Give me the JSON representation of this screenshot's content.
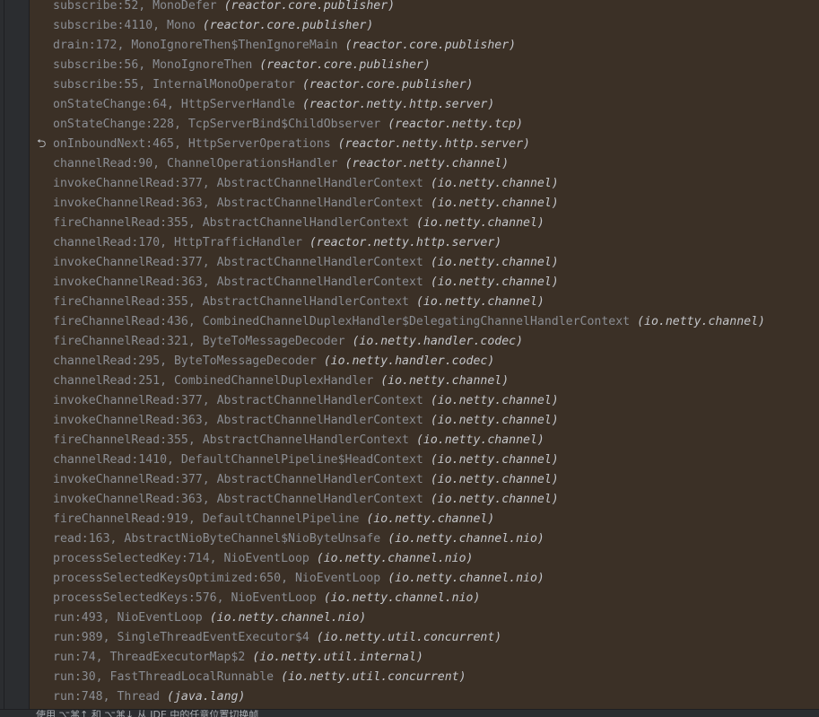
{
  "stack_frames": [
    {
      "method": "subscribe:52, MonoDefer",
      "package": "(reactor.core.publisher)"
    },
    {
      "method": "subscribe:4110, Mono",
      "package": "(reactor.core.publisher)"
    },
    {
      "method": "drain:172, MonoIgnoreThen$ThenIgnoreMain",
      "package": "(reactor.core.publisher)"
    },
    {
      "method": "subscribe:56, MonoIgnoreThen",
      "package": "(reactor.core.publisher)"
    },
    {
      "method": "subscribe:55, InternalMonoOperator",
      "package": "(reactor.core.publisher)"
    },
    {
      "method": "onStateChange:64, HttpServerHandle",
      "package": "(reactor.netty.http.server)"
    },
    {
      "method": "onStateChange:228, TcpServerBind$ChildObserver",
      "package": "(reactor.netty.tcp)"
    },
    {
      "method": "onInboundNext:465, HttpServerOperations",
      "package": "(reactor.netty.http.server)",
      "icon": "undo-arrow-icon",
      "icon_glyph": "⮌"
    },
    {
      "method": "channelRead:90, ChannelOperationsHandler",
      "package": "(reactor.netty.channel)"
    },
    {
      "method": "invokeChannelRead:377, AbstractChannelHandlerContext",
      "package": "(io.netty.channel)"
    },
    {
      "method": "invokeChannelRead:363, AbstractChannelHandlerContext",
      "package": "(io.netty.channel)"
    },
    {
      "method": "fireChannelRead:355, AbstractChannelHandlerContext",
      "package": "(io.netty.channel)"
    },
    {
      "method": "channelRead:170, HttpTrafficHandler",
      "package": "(reactor.netty.http.server)"
    },
    {
      "method": "invokeChannelRead:377, AbstractChannelHandlerContext",
      "package": "(io.netty.channel)"
    },
    {
      "method": "invokeChannelRead:363, AbstractChannelHandlerContext",
      "package": "(io.netty.channel)"
    },
    {
      "method": "fireChannelRead:355, AbstractChannelHandlerContext",
      "package": "(io.netty.channel)"
    },
    {
      "method": "fireChannelRead:436, CombinedChannelDuplexHandler$DelegatingChannelHandlerContext",
      "package": "(io.netty.channel)"
    },
    {
      "method": "fireChannelRead:321, ByteToMessageDecoder",
      "package": "(io.netty.handler.codec)"
    },
    {
      "method": "channelRead:295, ByteToMessageDecoder",
      "package": "(io.netty.handler.codec)"
    },
    {
      "method": "channelRead:251, CombinedChannelDuplexHandler",
      "package": "(io.netty.channel)"
    },
    {
      "method": "invokeChannelRead:377, AbstractChannelHandlerContext",
      "package": "(io.netty.channel)"
    },
    {
      "method": "invokeChannelRead:363, AbstractChannelHandlerContext",
      "package": "(io.netty.channel)"
    },
    {
      "method": "fireChannelRead:355, AbstractChannelHandlerContext",
      "package": "(io.netty.channel)"
    },
    {
      "method": "channelRead:1410, DefaultChannelPipeline$HeadContext",
      "package": "(io.netty.channel)"
    },
    {
      "method": "invokeChannelRead:377, AbstractChannelHandlerContext",
      "package": "(io.netty.channel)"
    },
    {
      "method": "invokeChannelRead:363, AbstractChannelHandlerContext",
      "package": "(io.netty.channel)"
    },
    {
      "method": "fireChannelRead:919, DefaultChannelPipeline",
      "package": "(io.netty.channel)"
    },
    {
      "method": "read:163, AbstractNioByteChannel$NioByteUnsafe",
      "package": "(io.netty.channel.nio)"
    },
    {
      "method": "processSelectedKey:714, NioEventLoop",
      "package": "(io.netty.channel.nio)"
    },
    {
      "method": "processSelectedKeysOptimized:650, NioEventLoop",
      "package": "(io.netty.channel.nio)"
    },
    {
      "method": "processSelectedKeys:576, NioEventLoop",
      "package": "(io.netty.channel.nio)"
    },
    {
      "method": "run:493, NioEventLoop",
      "package": "(io.netty.channel.nio)"
    },
    {
      "method": "run:989, SingleThreadEventExecutor$4",
      "package": "(io.netty.util.concurrent)"
    },
    {
      "method": "run:74, ThreadExecutorMap$2",
      "package": "(io.netty.util.internal)"
    },
    {
      "method": "run:30, FastThreadLocalRunnable",
      "package": "(io.netty.util.concurrent)"
    },
    {
      "method": "run:748, Thread",
      "package": "(java.lang)"
    }
  ],
  "status_bar": {
    "hint": "使用 ⌥⌘↑ 和 ⌥⌘↓ 从 IDE 中的任意位置切换帧"
  },
  "colors": {
    "frames_background": "#3b3026",
    "method_text": "#8a8d93",
    "package_text": "#c3c5c9",
    "gutter": "#2b2d30"
  }
}
